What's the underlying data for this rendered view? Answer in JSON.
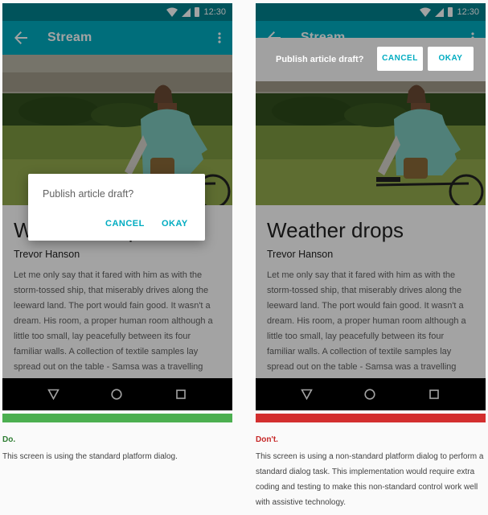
{
  "status_bar": {
    "time": "12:30"
  },
  "app_bar": {
    "title": "Stream"
  },
  "article": {
    "title": "Weather drops",
    "author": "Trevor Hanson",
    "body": "Let me only say that it fared with him as with the storm-tossed ship, that miserably drives along the leeward land. The port would fain good. It wasn't a dream. His room, a proper human room although a little too small, lay peacefully between its four familiar walls. A collection of textile samples lay spread out on the table - Samsa was a travelling salesman - and above it there hung a picture that he"
  },
  "do_example": {
    "dialog_title": "Publish article draft?",
    "cancel_label": "CANCEL",
    "okay_label": "OKAY",
    "indicator_color": "#4caf50",
    "label": "Do.",
    "label_color": "#2e7d32",
    "text": "This screen is using the standard platform dialog."
  },
  "dont_example": {
    "prompt_text": "Publish article draft?",
    "cancel_label": "CANCEL",
    "okay_label": "OKAY",
    "indicator_color": "#d32f2f",
    "label": "Don't.",
    "label_color": "#c62828",
    "text": "This screen is using a non-standard platform dialog to perform a standard dialog task. This implementation would require extra coding and testing to make this non-standard control work well with assistive technology."
  },
  "colors": {
    "status_bar": "#00838f",
    "app_bar": "#00acc1",
    "accent": "#00acc1"
  },
  "icons": [
    "back-arrow-icon",
    "overflow-menu-icon",
    "wifi-icon",
    "signal-icon",
    "battery-icon",
    "nav-back-icon",
    "nav-home-icon",
    "nav-recents-icon"
  ]
}
